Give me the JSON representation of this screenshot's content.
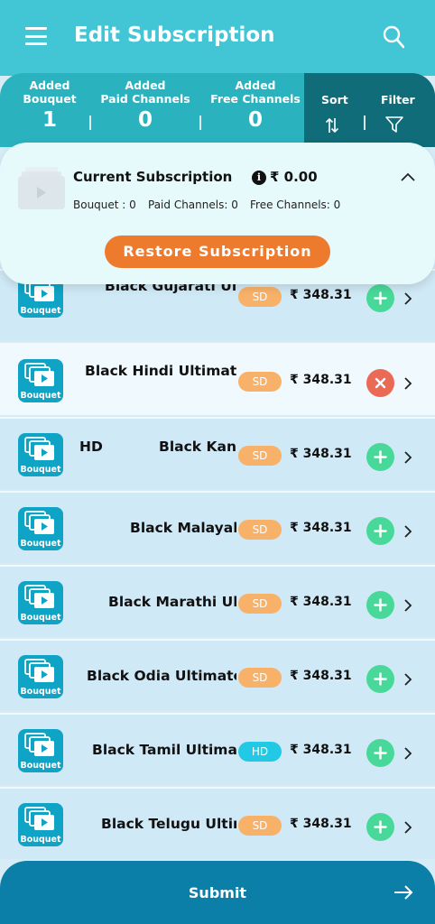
{
  "header": {
    "title": "Edit Subscription",
    "menu_icon": "hamburger-menu-icon",
    "search_icon": "search-icon"
  },
  "stats": {
    "bouquet": {
      "label_line1": "Added",
      "label_line2": "Bouquet",
      "value": "1"
    },
    "paid": {
      "label_line1": "Added",
      "label_line2": "Paid Channels",
      "value": "0"
    },
    "free": {
      "label_line1": "Added",
      "label_line2": "Free Channels",
      "value": "0"
    },
    "sort_label": "Sort",
    "filter_label": "Filter"
  },
  "current": {
    "title": "Current Subscription",
    "amount": "₹ 0.00",
    "bouquet_count": "Bouquet : 0",
    "paid_count": "Paid Channels: 0",
    "free_count": "Free Channels: 0",
    "restore_label": "Restore Subscription"
  },
  "badge_label": "Bouquet",
  "items": [
    {
      "name": "Black Gujarati Ultimate",
      "prefix": "",
      "tag": "SD",
      "price": "₹ 348.31",
      "added": false
    },
    {
      "name": "Black Hindi Ultimate",
      "prefix": "",
      "tag": "SD",
      "price": "₹ 348.31",
      "added": true
    },
    {
      "name": "Black Kannada",
      "prefix": "HD",
      "tag": "SD",
      "price": "₹ 348.31",
      "added": false
    },
    {
      "name": "Black Malayalam",
      "prefix": "",
      "tag": "SD",
      "price": "₹ 348.31",
      "added": false
    },
    {
      "name": "Black Marathi Ultimate",
      "prefix": "",
      "tag": "SD",
      "price": "₹ 348.31",
      "added": false
    },
    {
      "name": "Black Odia Ultimate",
      "prefix": "",
      "tag": "SD",
      "price": "₹ 348.31",
      "added": false
    },
    {
      "name": "Black Tamil Ultimate",
      "prefix": "",
      "tag": "HD",
      "price": "₹ 348.31",
      "added": false
    },
    {
      "name": "Black Telugu Ultimate",
      "prefix": "",
      "tag": "SD",
      "price": "₹ 348.31",
      "added": false
    }
  ],
  "submit_label": "Submit",
  "colors": {
    "header": "#42c6d6",
    "accent": "#ee7a2e",
    "add": "#48d99a",
    "remove": "#ea6a56",
    "submit": "#0b7fa8"
  }
}
